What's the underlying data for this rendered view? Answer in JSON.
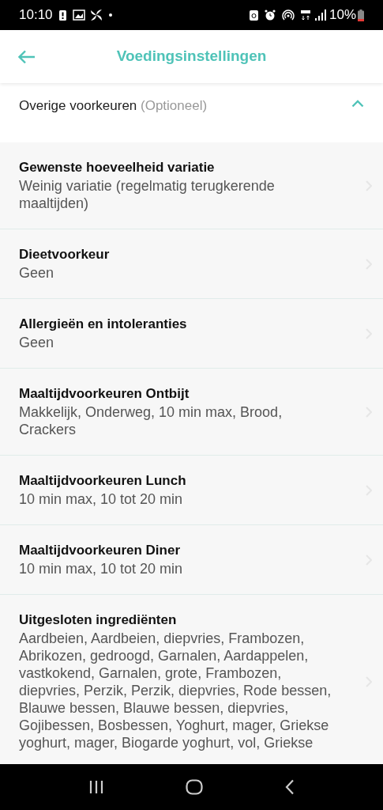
{
  "status_bar": {
    "time": "10:10",
    "battery": "10%"
  },
  "header": {
    "title": "Voedingsinstellingen"
  },
  "section": {
    "title": "Overige voorkeuren",
    "hint": "(Optioneel)",
    "expanded": true
  },
  "rows": [
    {
      "title": "Gewenste hoeveelheid variatie",
      "value": "Weinig variatie (regelmatig terugkerende maaltijden)"
    },
    {
      "title": "Dieetvoorkeur",
      "value": "Geen"
    },
    {
      "title": "Allergieën en intoleranties",
      "value": "Geen"
    },
    {
      "title": "Maaltijdvoorkeuren Ontbijt",
      "value": "Makkelijk, Onderweg, 10 min max, Brood, Crackers"
    },
    {
      "title": "Maaltijdvoorkeuren Lunch",
      "value": "10 min max, 10 tot 20 min"
    },
    {
      "title": "Maaltijdvoorkeuren Diner",
      "value": "10 min max, 10 tot 20 min"
    },
    {
      "title": "Uitgesloten ingrediënten",
      "value": "Aardbeien, Aardbeien, diepvries, Frambozen, Abrikozen, gedroogd, Garnalen, Aardappelen, vastkokend, Garnalen, grote, Frambozen, diepvries, Perzik, Perzik, diepvries, Rode bessen, Blauwe bessen, Blauwe bessen, diepvries, Gojibessen, Bosbessen, Yoghurt, mager, Griekse yoghurt, mager, Biogarde yoghurt, vol, Griekse"
    }
  ]
}
